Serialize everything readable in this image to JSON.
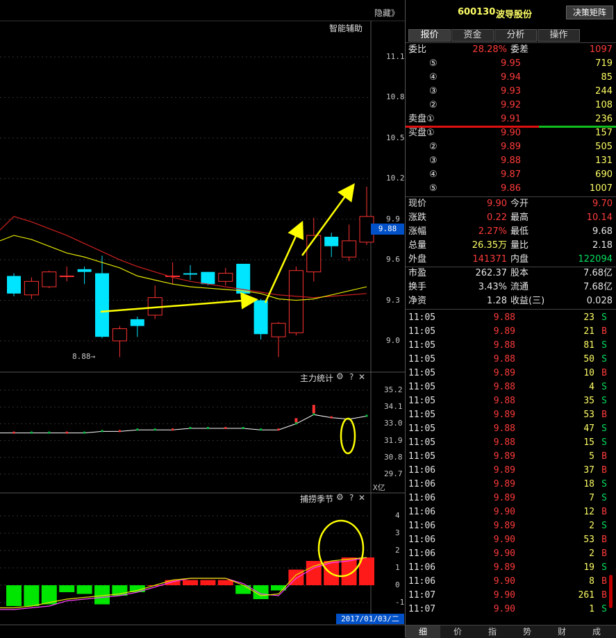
{
  "chart": {
    "hide_label": "隐藏》",
    "assist_label": "智能辅助",
    "price_ticks": [
      "11.1",
      "10.8",
      "10.5",
      "10.2",
      "9.9",
      "9.6",
      "9.3",
      "9.0"
    ],
    "current_price_tag": "9.88",
    "low_marker": "8.88→",
    "panel2_title": "主力统计",
    "panel2_ticks": [
      "35.2",
      "34.1",
      "33.0",
      "31.9",
      "30.8",
      "29.7"
    ],
    "panel2_unit": "X亿",
    "panel3_title": "捕捞季节",
    "panel3_ticks": [
      "4",
      "3",
      "2",
      "1",
      "0",
      "-1"
    ],
    "date_label": "2017/01/03/二",
    "gear_glyph": "⚙",
    "help_glyph": "?",
    "close_glyph": "✕",
    "candles": [
      {
        "o": 9.48,
        "c": 9.35,
        "h": 9.5,
        "l": 9.33
      },
      {
        "o": 9.34,
        "c": 9.44,
        "h": 9.47,
        "l": 9.31
      },
      {
        "o": 9.4,
        "c": 9.51,
        "h": 9.52,
        "l": 9.39
      },
      {
        "o": 9.48,
        "c": 9.48,
        "h": 9.55,
        "l": 9.44
      },
      {
        "o": 9.53,
        "c": 9.51,
        "h": 9.55,
        "l": 9.42
      },
      {
        "o": 9.5,
        "c": 9.03,
        "h": 9.63,
        "l": 9.02
      },
      {
        "o": 9.0,
        "c": 9.09,
        "h": 9.11,
        "l": 8.88
      },
      {
        "o": 9.16,
        "c": 9.11,
        "h": 9.18,
        "l": 9.03
      },
      {
        "o": 9.19,
        "c": 9.32,
        "h": 9.41,
        "l": 9.16
      },
      {
        "o": 9.48,
        "c": 9.48,
        "h": 9.58,
        "l": 9.42
      },
      {
        "o": 9.5,
        "c": 9.49,
        "h": 9.56,
        "l": 9.45
      },
      {
        "o": 9.51,
        "c": 9.42,
        "h": 9.51,
        "l": 9.41
      },
      {
        "o": 9.44,
        "c": 9.5,
        "h": 9.54,
        "l": 9.41
      },
      {
        "o": 9.57,
        "c": 9.35,
        "h": 9.57,
        "l": 9.32
      },
      {
        "o": 9.3,
        "c": 9.05,
        "h": 9.31,
        "l": 9.01
      },
      {
        "o": 9.03,
        "c": 9.13,
        "h": 9.14,
        "l": 8.88
      },
      {
        "o": 9.06,
        "c": 9.52,
        "h": 9.55,
        "l": 9.04
      },
      {
        "o": 9.51,
        "c": 9.78,
        "h": 9.91,
        "l": 9.44
      },
      {
        "o": 9.77,
        "c": 9.7,
        "h": 9.8,
        "l": 9.62
      },
      {
        "o": 9.62,
        "c": 9.74,
        "h": 9.86,
        "l": 9.59
      },
      {
        "o": 9.73,
        "c": 9.92,
        "h": 10.14,
        "l": 9.71
      }
    ],
    "ma_fast": [
      9.78,
      9.75,
      9.7,
      9.65,
      9.62,
      9.58,
      9.54,
      9.48,
      9.45,
      9.42,
      9.4,
      9.39,
      9.38,
      9.37,
      9.35,
      9.31,
      9.3,
      9.31,
      9.34,
      9.37,
      9.4
    ],
    "ma_slow": [
      9.92,
      9.88,
      9.83,
      9.78,
      9.72,
      9.66,
      9.6,
      9.55,
      9.51,
      9.47,
      9.44,
      9.42,
      9.4,
      9.38,
      9.36,
      9.34,
      9.33,
      9.32,
      9.33,
      9.34,
      9.35
    ],
    "p2_line": [
      32.4,
      32.4,
      32.4,
      32.4,
      32.4,
      32.5,
      32.5,
      32.6,
      32.6,
      32.6,
      32.7,
      32.7,
      32.7,
      32.7,
      32.6,
      32.6,
      33.0,
      33.6,
      33.4,
      33.3,
      33.5
    ],
    "p3_bars": [
      -1.2,
      -1.2,
      -1.1,
      -0.4,
      -0.5,
      -1.1,
      -0.6,
      -0.4,
      0.0,
      0.3,
      0.3,
      0.3,
      0.3,
      -0.5,
      -0.8,
      -0.3,
      0.9,
      1.4,
      1.4,
      1.6,
      1.6
    ],
    "p3_line_y": [
      -1.3,
      -1.2,
      -1.0,
      -0.8,
      -0.7,
      -0.6,
      -0.5,
      -0.3,
      0.0,
      0.3,
      0.4,
      0.4,
      0.4,
      0.0,
      -0.6,
      -0.5,
      0.6,
      1.1,
      1.4,
      1.5,
      1.6
    ],
    "p3_line_m": [
      -1.4,
      -1.3,
      -1.2,
      -0.9,
      -0.8,
      -0.7,
      -0.6,
      -0.4,
      -0.1,
      0.2,
      0.4,
      0.4,
      0.4,
      0.1,
      -0.5,
      -0.6,
      0.4,
      1.0,
      1.3,
      1.4,
      1.6
    ]
  },
  "quote": {
    "code": "600130",
    "name": "波导股份",
    "decision_button": "决策矩阵",
    "tabs": [
      "报价",
      "资金",
      "分析",
      "操作"
    ],
    "weibi_label": "委比",
    "weibi_value": "28.28%",
    "weicha_label": "委差",
    "weicha_value": "1097",
    "sell": [
      {
        "label": "⑤",
        "price": "9.95",
        "vol": "719"
      },
      {
        "label": "④",
        "price": "9.94",
        "vol": "85"
      },
      {
        "label": "③",
        "price": "9.93",
        "vol": "244"
      },
      {
        "label": "②",
        "price": "9.92",
        "vol": "108"
      },
      {
        "label": "卖盘①",
        "price": "9.91",
        "vol": "236"
      }
    ],
    "buy": [
      {
        "label": "买盘①",
        "price": "9.90",
        "vol": "157"
      },
      {
        "label": "②",
        "price": "9.89",
        "vol": "505"
      },
      {
        "label": "③",
        "price": "9.88",
        "vol": "131"
      },
      {
        "label": "④",
        "price": "9.87",
        "vol": "690"
      },
      {
        "label": "⑤",
        "price": "9.86",
        "vol": "1007"
      }
    ],
    "stats": [
      {
        "l1": "现价",
        "v1": "9.90",
        "c1": "red",
        "l2": "今开",
        "v2": "9.70",
        "c2": "red"
      },
      {
        "l1": "涨跌",
        "v1": "0.22",
        "c1": "red",
        "l2": "最高",
        "v2": "10.14",
        "c2": "red"
      },
      {
        "l1": "涨幅",
        "v1": "2.27%",
        "c1": "red",
        "l2": "最低",
        "v2": "9.68",
        "c2": "white"
      },
      {
        "l1": "总量",
        "v1": "26.35万",
        "c1": "yellow",
        "l2": "量比",
        "v2": "2.18",
        "c2": "white"
      },
      {
        "l1": "外盘",
        "v1": "141371",
        "c1": "red",
        "l2": "内盘",
        "v2": "122094",
        "c2": "green"
      }
    ],
    "stats2": [
      {
        "l1": "市盈",
        "v1": "262.37",
        "l2": "股本",
        "v2": "7.68亿"
      },
      {
        "l1": "换手",
        "v1": "3.43%",
        "l2": "流通",
        "v2": "7.68亿"
      },
      {
        "l1": "净资",
        "v1": "1.28",
        "l2": "收益(三)",
        "v2": "0.028"
      }
    ],
    "ticks": [
      {
        "t": "11:05",
        "p": "9.88",
        "v": "23",
        "s": "S"
      },
      {
        "t": "11:05",
        "p": "9.89",
        "v": "21",
        "s": "B"
      },
      {
        "t": "11:05",
        "p": "9.88",
        "v": "81",
        "s": "S"
      },
      {
        "t": "11:05",
        "p": "9.88",
        "v": "50",
        "s": "S"
      },
      {
        "t": "11:05",
        "p": "9.89",
        "v": "10",
        "s": "B"
      },
      {
        "t": "11:05",
        "p": "9.88",
        "v": "4",
        "s": "S"
      },
      {
        "t": "11:05",
        "p": "9.88",
        "v": "35",
        "s": "S"
      },
      {
        "t": "11:05",
        "p": "9.89",
        "v": "53",
        "s": "B"
      },
      {
        "t": "11:05",
        "p": "9.88",
        "v": "47",
        "s": "S"
      },
      {
        "t": "11:05",
        "p": "9.88",
        "v": "15",
        "s": "S"
      },
      {
        "t": "11:05",
        "p": "9.89",
        "v": "5",
        "s": "B"
      },
      {
        "t": "11:06",
        "p": "9.89",
        "v": "37",
        "s": "B"
      },
      {
        "t": "11:06",
        "p": "9.89",
        "v": "18",
        "s": "S"
      },
      {
        "t": "11:06",
        "p": "9.89",
        "v": "7",
        "s": "S"
      },
      {
        "t": "11:06",
        "p": "9.90",
        "v": "12",
        "s": "B"
      },
      {
        "t": "11:06",
        "p": "9.89",
        "v": "2",
        "s": "S"
      },
      {
        "t": "11:06",
        "p": "9.90",
        "v": "53",
        "s": "B"
      },
      {
        "t": "11:06",
        "p": "9.90",
        "v": "2",
        "s": "B"
      },
      {
        "t": "11:06",
        "p": "9.89",
        "v": "19",
        "s": "S"
      },
      {
        "t": "11:06",
        "p": "9.90",
        "v": "8",
        "s": "B"
      },
      {
        "t": "11:07",
        "p": "9.90",
        "v": "261",
        "s": "B"
      },
      {
        "t": "11:07",
        "p": "9.90",
        "v": "1",
        "s": "S"
      }
    ],
    "bottom_tabs": [
      "细",
      "价",
      "指",
      "势",
      "财",
      "成"
    ]
  }
}
